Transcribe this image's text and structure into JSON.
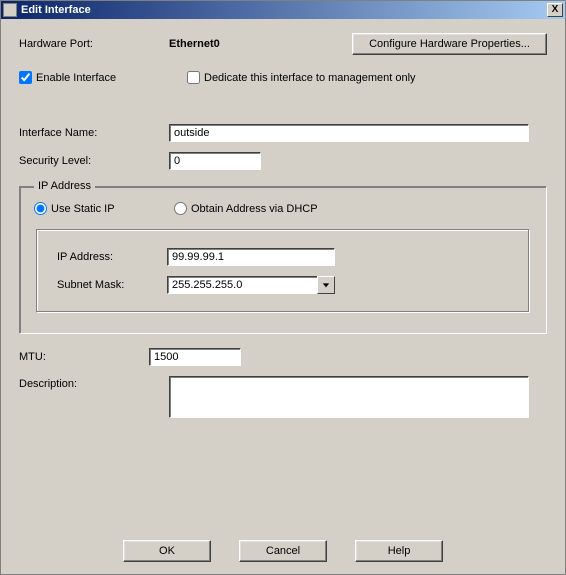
{
  "window": {
    "title": "Edit Interface"
  },
  "header": {
    "hardware_port_label": "Hardware Port:",
    "hardware_port_value": "Ethernet0",
    "configure_button": "Configure Hardware Properties..."
  },
  "options": {
    "enable_interface_label": "Enable Interface",
    "enable_interface_checked": true,
    "dedicate_mgmt_label": "Dedicate this interface to management only",
    "dedicate_mgmt_checked": false
  },
  "fields": {
    "interface_name_label": "Interface Name:",
    "interface_name_value": "outside",
    "security_level_label": "Security Level:",
    "security_level_value": "0",
    "mtu_label": "MTU:",
    "mtu_value": "1500",
    "description_label": "Description:",
    "description_value": ""
  },
  "ip": {
    "legend": "IP Address",
    "static_label": "Use Static IP",
    "dhcp_label": "Obtain Address via DHCP",
    "mode": "static",
    "ip_address_label": "IP Address:",
    "ip_address_value": "99.99.99.1",
    "subnet_mask_label": "Subnet Mask:",
    "subnet_mask_value": "255.255.255.0"
  },
  "footer": {
    "ok": "OK",
    "cancel": "Cancel",
    "help": "Help"
  }
}
